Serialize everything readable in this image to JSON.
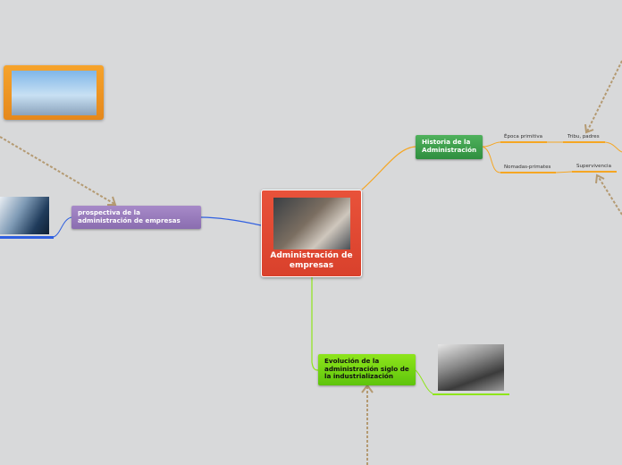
{
  "central": {
    "title": "Administración de empresas",
    "image_icon": "business-meeting-photo-icon"
  },
  "topics": {
    "historia": {
      "label": "Historia de la Administración",
      "color": "#3fa04e"
    },
    "evolucion": {
      "label": "Evolución de la administración siglo de la industrialización",
      "color": "#7ad415"
    },
    "prospectiva": {
      "label": "prospectiva de la administración de empresas",
      "color": "#9a7dbd"
    }
  },
  "subtopics": {
    "epoca": "Época primitiva",
    "nomadas": "Nomadas-primates",
    "tribu": "Tribu, padres",
    "supervivencia": "Supervivencia"
  },
  "images": {
    "top": "business-people-crowd-photo-icon",
    "left": "chess-pieces-photo-icon",
    "factory": "factory-workers-photo-icon"
  },
  "colors": {
    "background": "#d8d9da",
    "central": "#e04a33",
    "link_orange": "#f5a623",
    "link_blue": "#2f5fe0",
    "link_green": "#8ee51b",
    "arrow": "#b49a72"
  }
}
